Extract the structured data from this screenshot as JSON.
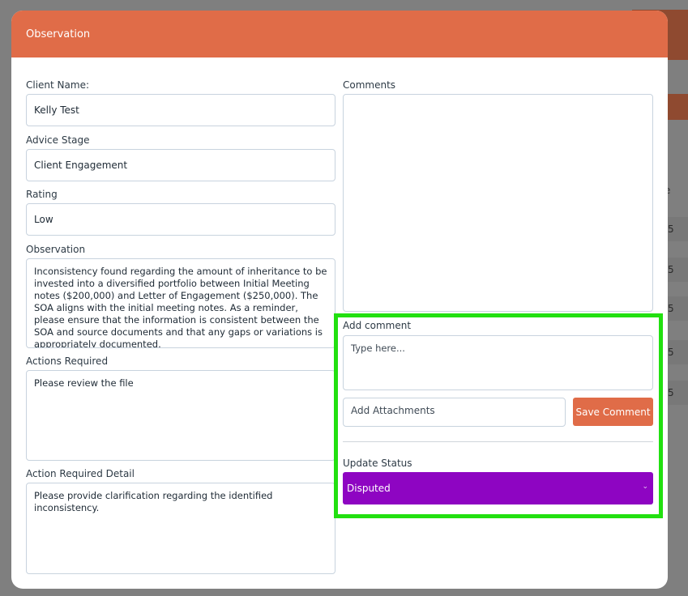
{
  "modal": {
    "title": "Observation"
  },
  "form": {
    "client_name_label": "Client Name:",
    "client_name_value": "Kelly Test",
    "advice_stage_label": "Advice Stage",
    "advice_stage_value": "Client Engagement",
    "rating_label": "Rating",
    "rating_value": "Low",
    "observation_label": "Observation",
    "observation_value": "Inconsistency found regarding the amount of inheritance to be invested into a diversified portfolio between Initial Meeting notes ($200,000) and Letter of Engagement ($250,000). The SOA aligns with the initial meeting notes. As a reminder, please ensure that the information is consistent between the SOA and source documents and that any gaps or variations is appropriately documented.",
    "actions_required_label": "Actions Required",
    "actions_required_value": "Please review the file",
    "action_required_detail_label": "Action Required Detail",
    "action_required_detail_value": "Please provide clarification regarding the identified inconsistency."
  },
  "comments": {
    "label": "Comments",
    "add_comment_label": "Add comment",
    "add_comment_placeholder": "Type here...",
    "attachments_placeholder": "Add Attachments",
    "save_button_label": "Save Comment"
  },
  "status": {
    "label": "Update Status",
    "selected": "Disputed",
    "color": "#8e05c2"
  },
  "theme": {
    "header_color": "#e06c48",
    "highlight_color": "#22e010"
  },
  "background": {
    "row_values": [
      "5",
      "5",
      "5",
      "5",
      "5"
    ]
  }
}
